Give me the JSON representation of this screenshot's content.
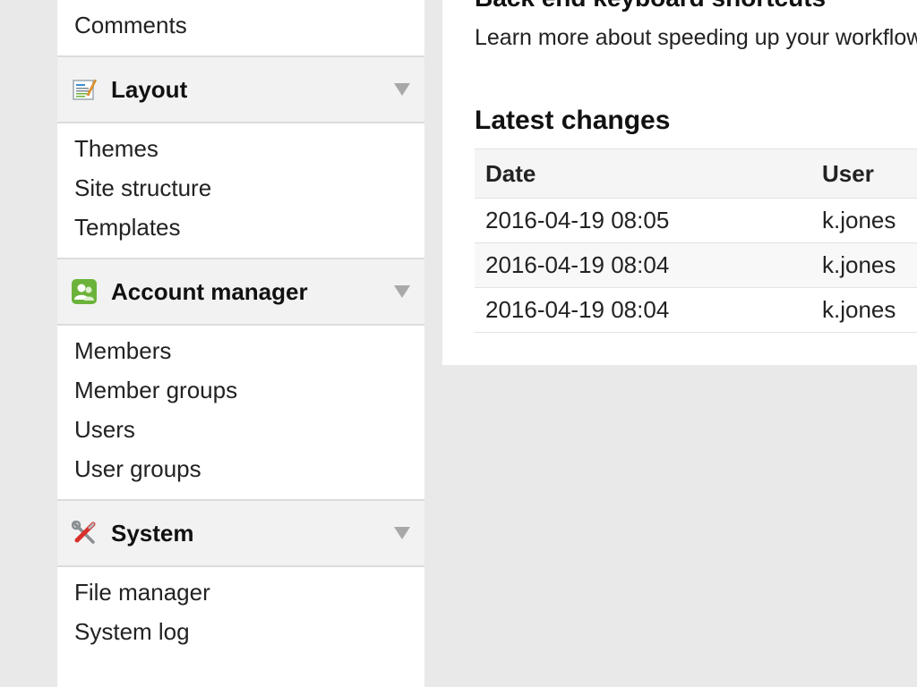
{
  "sidebar": {
    "top_links": [
      "Comments"
    ],
    "groups": [
      {
        "title": "Layout",
        "icon": "layout-icon",
        "links": [
          "Themes",
          "Site structure",
          "Templates"
        ]
      },
      {
        "title": "Account manager",
        "icon": "account-manager-icon",
        "links": [
          "Members",
          "Member groups",
          "Users",
          "User groups"
        ]
      },
      {
        "title": "System",
        "icon": "system-tools-icon",
        "links": [
          "File manager",
          "System log"
        ]
      }
    ]
  },
  "main": {
    "shortcuts_heading": "Back end keyboard shortcuts",
    "shortcuts_text": "Learn more about speeding up your workflow",
    "changes_heading": "Latest changes",
    "table": {
      "headers": [
        "Date",
        "User"
      ],
      "rows": [
        [
          "2016-04-19 08:05",
          "k.jones"
        ],
        [
          "2016-04-19 08:04",
          "k.jones"
        ],
        [
          "2016-04-19 08:04",
          "k.jones"
        ]
      ]
    }
  },
  "colors": {
    "background": "#e9e9e9",
    "panel": "#ffffff",
    "group_header": "#f2f2f2",
    "account_icon": "#6bb33a",
    "system_icon_red": "#d9302c"
  }
}
